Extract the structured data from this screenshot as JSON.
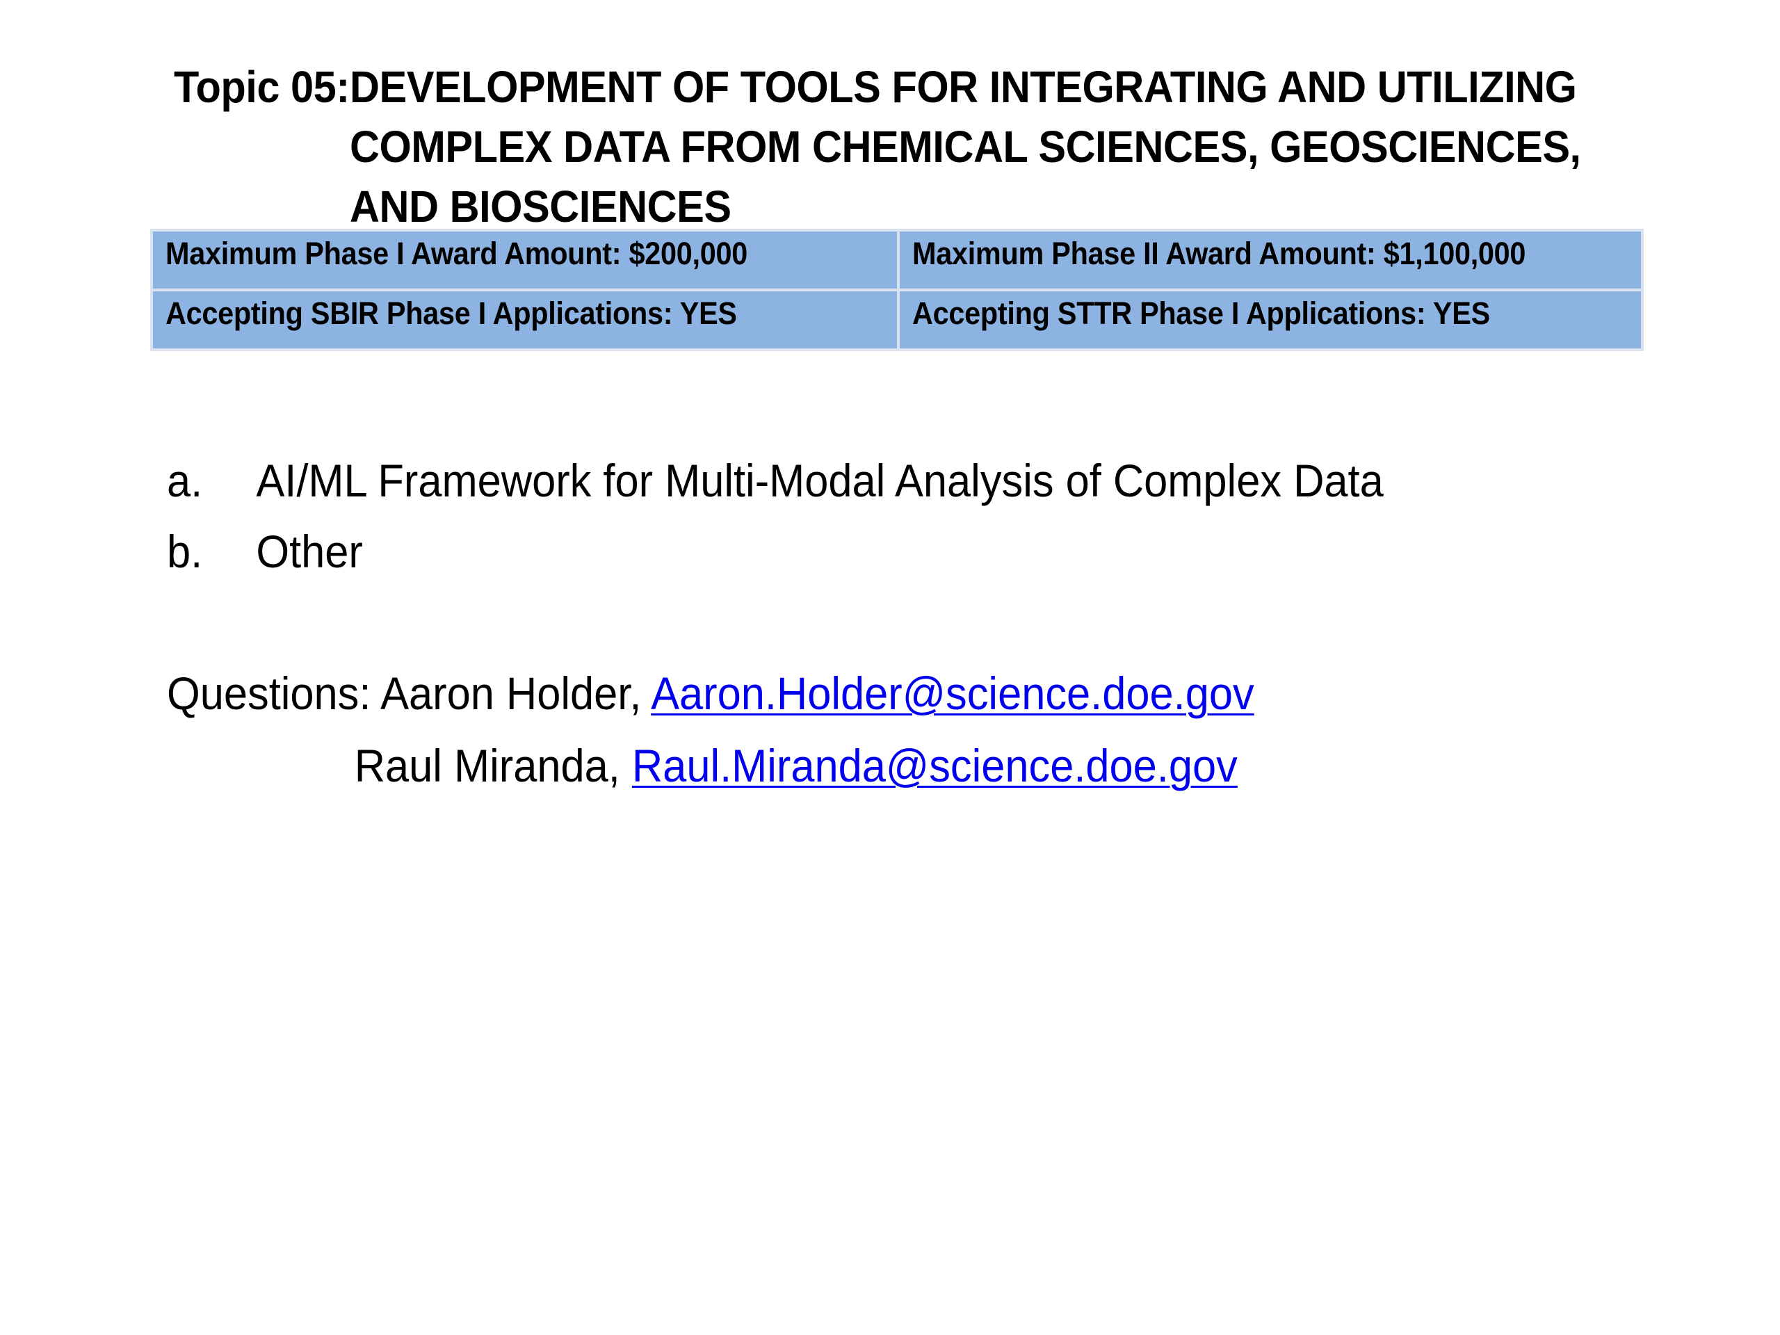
{
  "title": {
    "prefix": "Topic 05:",
    "lines": [
      "DEVELOPMENT OF TOOLS FOR INTEGRATING AND UTILIZING",
      "COMPLEX DATA FROM CHEMICAL SCIENCES, GEOSCIENCES,",
      "AND BIOSCIENCES"
    ]
  },
  "award_table": {
    "rows": [
      [
        "Maximum Phase I Award Amount:  $200,000",
        "Maximum Phase II Award Amount:  $1,100,000"
      ],
      [
        "Accepting SBIR Phase I Applications:  YES",
        "Accepting STTR Phase I Applications:  YES"
      ]
    ],
    "cell_color": "#8db3e2"
  },
  "subtopics": [
    {
      "letter": "a.",
      "text": "AI/ML Framework for Multi-Modal Analysis of Complex Data"
    },
    {
      "letter": "b.",
      "text": "Other"
    }
  ],
  "questions": {
    "label": "Questions:",
    "contacts": [
      {
        "name": "Aaron Holder,",
        "email": "Aaron.Holder@science.doe.gov"
      },
      {
        "name": "Raul Miranda,",
        "email": "Raul.Miranda@science.doe.gov"
      }
    ],
    "link_color": "#0000ee"
  }
}
